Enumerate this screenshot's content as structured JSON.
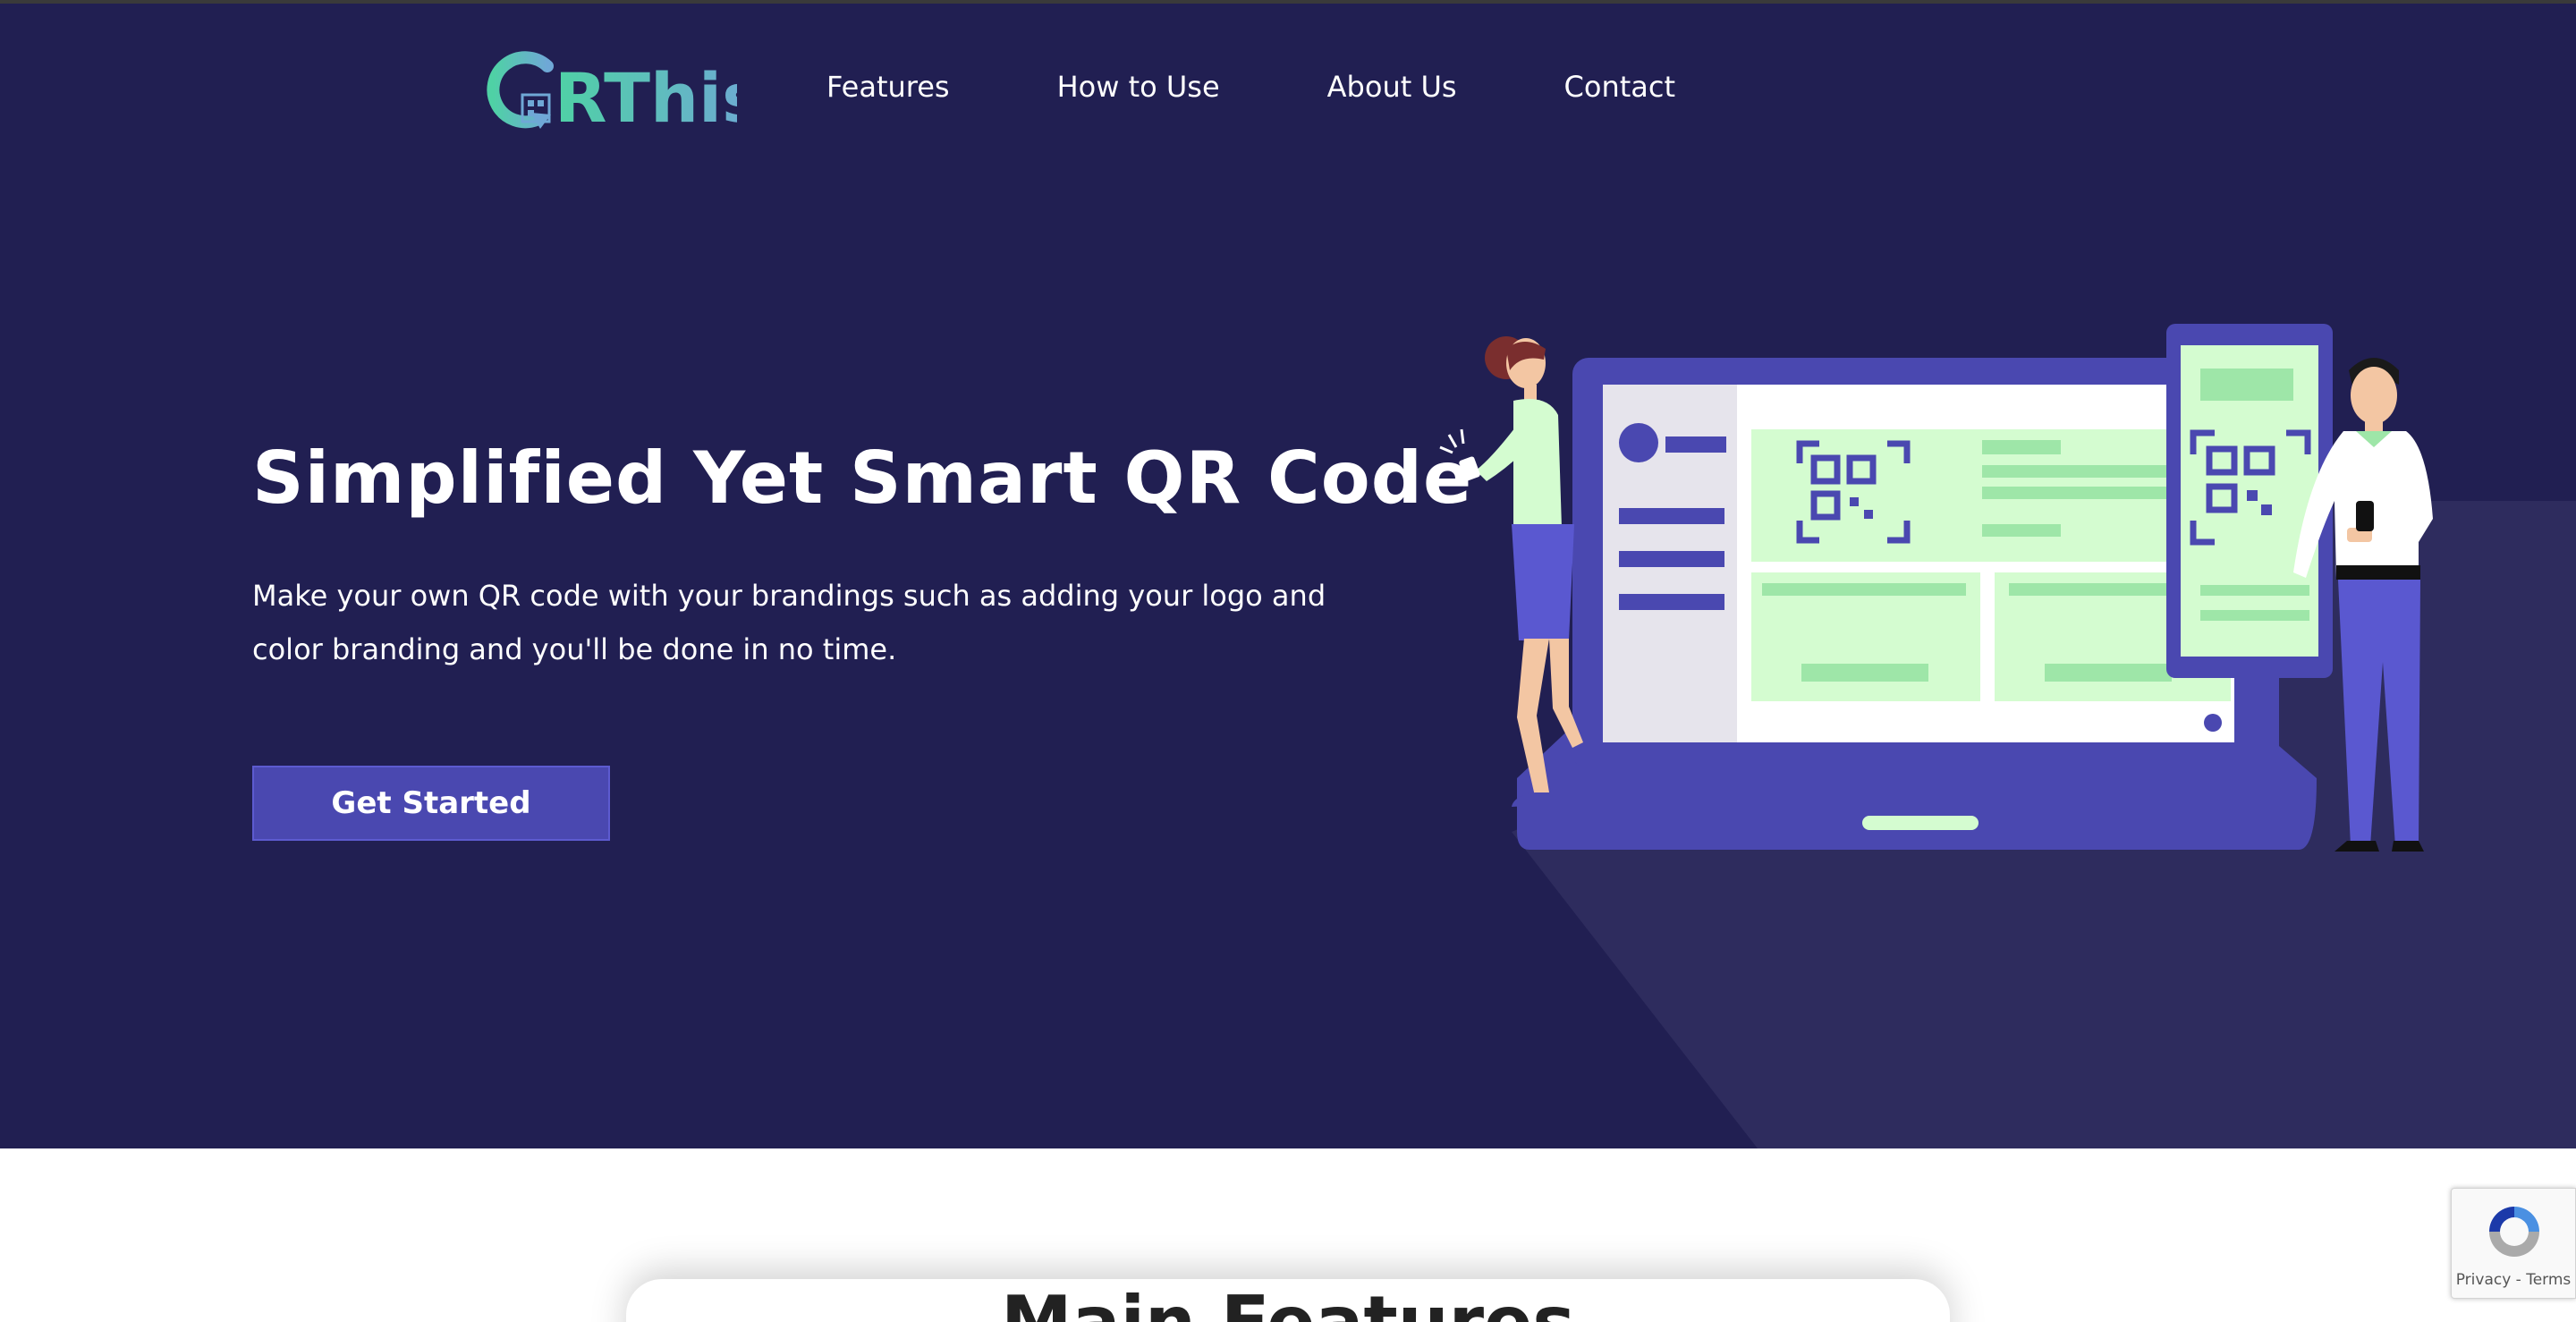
{
  "brand": {
    "logo_text": "RThis",
    "colors": {
      "hero_bg": "#211f52",
      "accent": "#4a48b0",
      "logo_gradient_start": "#4fd1a5",
      "logo_gradient_end": "#6fa8d6",
      "illustration_green": "#d4fcd0"
    }
  },
  "nav": {
    "items": [
      {
        "label": "Features"
      },
      {
        "label": "How to Use"
      },
      {
        "label": "About Us"
      },
      {
        "label": "Contact"
      }
    ]
  },
  "hero": {
    "title": "Simplified Yet Smart QR Code",
    "subtitle": "Make your own QR code with your brandings such as adding your logo and color branding and you'll be done in no time.",
    "cta_label": "Get Started"
  },
  "features": {
    "title": "Main Features"
  },
  "recaptcha": {
    "links": "Privacy - Terms"
  },
  "icons": {
    "logo": "qr-logo-icon",
    "recaptcha": "recaptcha-icon"
  }
}
